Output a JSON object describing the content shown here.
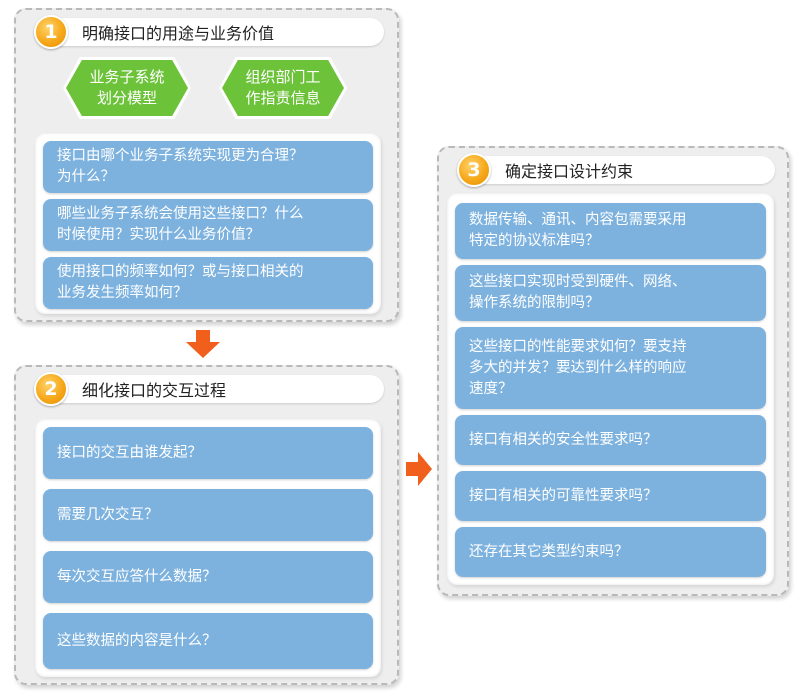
{
  "colors": {
    "panel_bg": "#eeeeee",
    "card_blue": "#7db2df",
    "hex_green": "#6cc33a",
    "number_orange": "#f6a81a",
    "arrow_orange": "#f0601c"
  },
  "section1": {
    "number": "1",
    "title": "明确接口的用途与业务价值",
    "tags": [
      {
        "line1": "业务子系统",
        "line2": "划分模型"
      },
      {
        "line1": "组织部门工",
        "line2": "作指责信息"
      }
    ],
    "items": [
      {
        "line1": "接口由哪个业务子系统实现更为合理？",
        "line2": "为什么？"
      },
      {
        "line1": "哪些业务子系统会使用这些接口？什么",
        "line2": "时候使用？实现什么业务价值？"
      },
      {
        "line1": "使用接口的频率如何？或与接口相关的",
        "line2": "业务发生频率如何？"
      }
    ]
  },
  "section2": {
    "number": "2",
    "title": "细化接口的交互过程",
    "items": [
      "接口的交互由谁发起？",
      "需要几次交互？",
      "每次交互应答什么数据？",
      "这些数据的内容是什么？"
    ]
  },
  "section3": {
    "number": "3",
    "title": "确定接口设计约束",
    "items": [
      {
        "lines": [
          "数据传输、通讯、内容包需要采用",
          "特定的协议标准吗？"
        ]
      },
      {
        "lines": [
          "这些接口实现时受到硬件、网络、",
          "操作系统的限制吗？"
        ]
      },
      {
        "lines": [
          "这些接口的性能要求如何？要支持",
          "多大的并发？要达到什么样的响应",
          "速度？"
        ]
      },
      {
        "lines": [
          "接口有相关的安全性要求吗？"
        ]
      },
      {
        "lines": [
          "接口有相关的可靠性要求吗？"
        ]
      },
      {
        "lines": [
          "还存在其它类型约束吗？"
        ]
      }
    ]
  },
  "arrows": {
    "down": "arrow-down",
    "right": "arrow-right"
  }
}
